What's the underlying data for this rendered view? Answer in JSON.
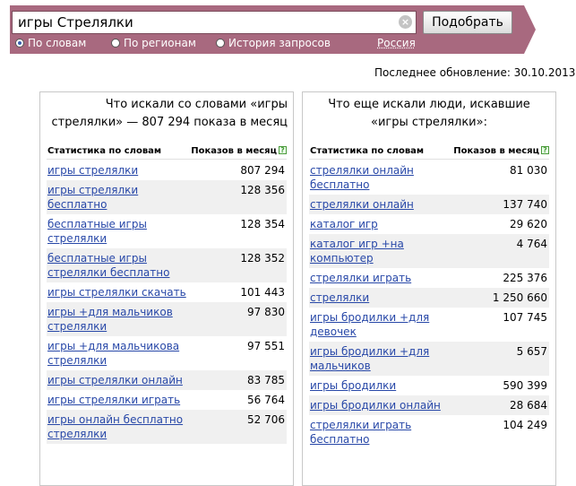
{
  "search": {
    "query": "игры Стрелялки",
    "submit_label": "Подобрать"
  },
  "options": {
    "by_words": "По словам",
    "by_regions": "По регионам",
    "history": "История запросов",
    "region": "Россия"
  },
  "last_update": "Последнее обновление: 30.10.2013",
  "left_panel": {
    "title": "Что искали со словами «игры стрелялки» — 807 294 показа в месяц",
    "col_query": "Статистика по словам",
    "col_count": "Показов в месяц",
    "rows": [
      {
        "q": "игры стрелялки",
        "n": "807 294"
      },
      {
        "q": "игры стрелялки бесплатно",
        "n": "128 356"
      },
      {
        "q": "бесплатные игры стрелялки",
        "n": "128 354"
      },
      {
        "q": "бесплатные игры стрелялки бесплатно",
        "n": "128 352"
      },
      {
        "q": "игры стрелялки скачать",
        "n": "101 443"
      },
      {
        "q": "игры +для мальчиков стрелялки",
        "n": "97 830"
      },
      {
        "q": "игры +для мальчикова стрелялки",
        "n": "97 551"
      },
      {
        "q": "игры стрелялки онлайн",
        "n": "83 785"
      },
      {
        "q": "игры стрелялки играть",
        "n": "56 764"
      },
      {
        "q": "игры онлайн бесплатно стрелялки",
        "n": "52 706"
      }
    ]
  },
  "right_panel": {
    "title": "Что еще искали люди, искавшие «игры стрелялки»:",
    "col_query": "Статистика по словам",
    "col_count": "Показов в месяц",
    "rows": [
      {
        "q": "стрелялки онлайн бесплатно",
        "n": "81 030"
      },
      {
        "q": "стрелялки онлайн",
        "n": "137 740"
      },
      {
        "q": "каталог игр",
        "n": "29 620"
      },
      {
        "q": "каталог игр +на компьютер",
        "n": "4 764"
      },
      {
        "q": "стрелялки играть",
        "n": "225 376"
      },
      {
        "q": "стрелялки",
        "n": "1 250 660"
      },
      {
        "q": "игры бродилки +для девочек",
        "n": "107 745"
      },
      {
        "q": "игры бродилки +для мальчиков",
        "n": "5 657"
      },
      {
        "q": "игры бродилки",
        "n": "590 399"
      },
      {
        "q": "игры бродилки онлайн",
        "n": "28 684"
      },
      {
        "q": "стрелялки играть бесплатно",
        "n": "104 249"
      }
    ]
  }
}
